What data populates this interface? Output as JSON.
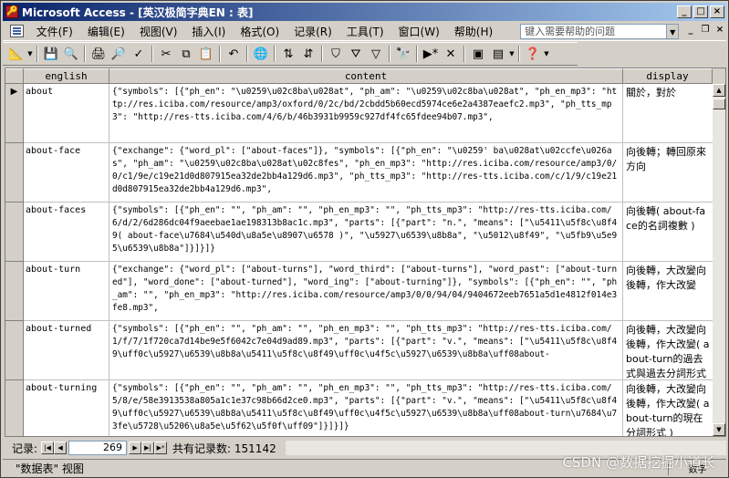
{
  "window": {
    "title": "Microsoft Access - [英汉极简字典EN : 表]"
  },
  "menu": {
    "items": [
      "文件(F)",
      "编辑(E)",
      "视图(V)",
      "插入(I)",
      "格式(O)",
      "记录(R)",
      "工具(T)",
      "窗口(W)",
      "帮助(H)"
    ],
    "help_placeholder": "键入需要帮助的问题"
  },
  "table": {
    "columns": [
      "english",
      "content",
      "display"
    ],
    "rows": [
      {
        "english": "about",
        "content": "{\"symbols\": [{\"ph_en\": \"\\u0259\\u02c8ba\\u028at\", \"ph_am\": \"\\u0259\\u02c8ba\\u028at\", \"ph_en_mp3\": \"http://res.iciba.com/resource/amp3/oxford/0/2c/bd/2cbdd5b60ecd5974ce6e2a4387eaefc2.mp3\", \"ph_tts_mp3\": \"http://res-tts.iciba.com/4/6/b/46b3931b9959c927df4fc65fdee94b07.mp3\",",
        "display": "關於，對於"
      },
      {
        "english": "about-face",
        "content": "{\"exchange\": {\"word_pl\": [\"about-faces\"]}, \"symbols\": [{\"ph_en\": \"\\u0259' ba\\u028at\\u02ccfe\\u026as\", \"ph_am\": \"\\u0259\\u02c8ba\\u028at\\u02c8fes\", \"ph_en_mp3\": \"http://res.iciba.com/resource/amp3/0/0/c1/9e/c19e21d0d807915ea32de2bb4a129d6.mp3\", \"ph_tts_mp3\": \"http://res-tts.iciba.com/c/1/9/c19e21d0d807915ea32de2bb4a129d6.mp3\",",
        "display": "向後轉；轉回原來方向"
      },
      {
        "english": "about-faces",
        "content": "{\"symbols\": [{\"ph_en\": \"\", \"ph_am\": \"\", \"ph_en_mp3\": \"\", \"ph_tts_mp3\": \"http://res-tts.iciba.com/6/d/2/6d286dc04f9aeebae1ae198313b8ac1c.mp3\", \"parts\": [{\"part\": \"n.\", \"means\": [\"\\u5411\\u5f8c\\u8f49( about-face\\u7684\\u540d\\u8a5e\\u8907\\u6578 )\", \"\\u5927\\u6539\\u8b8a\", \"\\u5012\\u8f49\", \"\\u5fb9\\u5e95\\u6539\\u8b8a\"]}]}]}",
        "display": "向後轉( about-face的名詞複數 )"
      },
      {
        "english": "about-turn",
        "content": "{\"exchange\": {\"word_pl\": [\"about-turns\"], \"word_third\": [\"about-turns\"], \"word_past\": [\"about-turned\"], \"word_done\": [\"about-turned\"], \"word_ing\": [\"about-turning\"]}, \"symbols\": [{\"ph_en\": \"\", \"ph_am\": \"\", \"ph_en_mp3\": \"http://res.iciba.com/resource/amp3/0/0/94/04/9404672eeb7651a5d1e4812f014e3fe8.mp3\",",
        "display": "向後轉，大改變向後轉，作大改變"
      },
      {
        "english": "about-turned",
        "content": "{\"symbols\": [{\"ph_en\": \"\", \"ph_am\": \"\", \"ph_en_mp3\": \"\", \"ph_tts_mp3\": \"http://res-tts.iciba.com/1/f/7/1f720ca7d14be9e5f6042c7e04d9ad89.mp3\", \"parts\": [{\"part\": \"v.\", \"means\": [\"\\u5411\\u5f8c\\u8f49\\uff0c\\u5927\\u6539\\u8b8a\\u5411\\u5f8c\\u8f49\\uff0c\\u4f5c\\u5927\\u6539\\u8b8a\\uff08about-",
        "display": "向後轉，大改變向後轉，作大改變( about-turn的過去式與過去分詞形式 )"
      },
      {
        "english": "about-turning",
        "content": "{\"symbols\": [{\"ph_en\": \"\", \"ph_am\": \"\", \"ph_en_mp3\": \"\", \"ph_tts_mp3\": \"http://res-tts.iciba.com/5/8/e/58e3913538a805a1c1e37c98b66d2ce0.mp3\", \"parts\": [{\"part\": \"v.\", \"means\": [\"\\u5411\\u5f8c\\u8f49\\uff0c\\u5927\\u6539\\u8b8a\\u5411\\u5f8c\\u8f49\\uff0c\\u4f5c\\u5927\\u6539\\u8b8a\\uff08about-turn\\u7684\\u73fe\\u5728\\u5206\\u8a5e\\u5f62\\u5f0f\\uff09\"]}]}]}",
        "display": "向後轉，大改變向後轉，作大改變( about-turn的現在分詞形式 )"
      }
    ]
  },
  "navigator": {
    "label": "记录:",
    "current": "269",
    "total_text": "共有记录数: 151142"
  },
  "status": {
    "text": "\"数据表\" 视图",
    "right": "数字"
  },
  "watermark": "CSDN @数据挖掘小道长"
}
